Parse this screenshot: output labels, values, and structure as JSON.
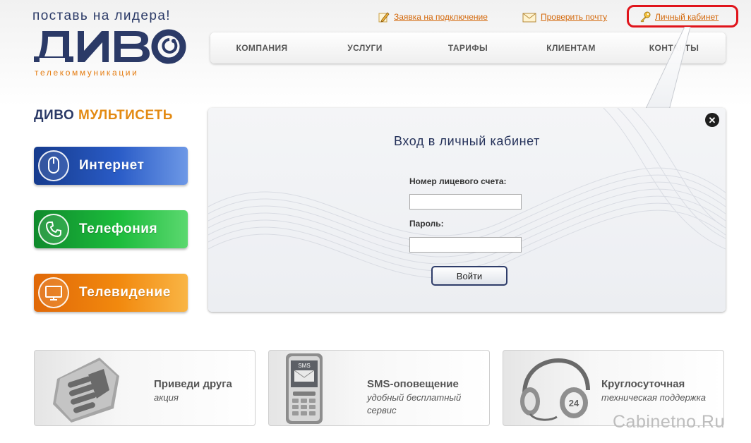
{
  "logo": {
    "tagline": "поставь на лидера!",
    "brand": "ДИВО",
    "subbrand": "телекоммуникации"
  },
  "top_links": {
    "request": "Заявка на подключение",
    "mail": "Проверить почту",
    "cabinet": "Личный кабинет"
  },
  "nav": {
    "items": [
      "КОМПАНИЯ",
      "УСЛУГИ",
      "ТАРИФЫ",
      "КЛИЕНТАМ",
      "КОНТАКТЫ"
    ]
  },
  "multiset": {
    "title_a": "ДИВО",
    "title_b": "МУЛЬТИСЕТЬ",
    "services": [
      "Интернет",
      "Телефония",
      "Телевидение"
    ]
  },
  "login": {
    "title": "Вход в личный кабинет",
    "account_label": "Номер лицевого счета:",
    "account_value": "",
    "password_label": "Пароль:",
    "password_value": "",
    "submit": "Войти"
  },
  "promo": [
    {
      "title": "Приведи друга",
      "sub": "акция"
    },
    {
      "title": "SMS-оповещение",
      "sub": "удобный бесплатный сервис",
      "icon_text": "SMS"
    },
    {
      "title": "Круглосуточная",
      "sub": "техническая поддержка"
    }
  ],
  "watermark": "Cabinetno.Ru",
  "colors": {
    "navy": "#2b3a67",
    "orange": "#e38a12",
    "link": "#d4690c",
    "highlight": "#e0141b"
  }
}
